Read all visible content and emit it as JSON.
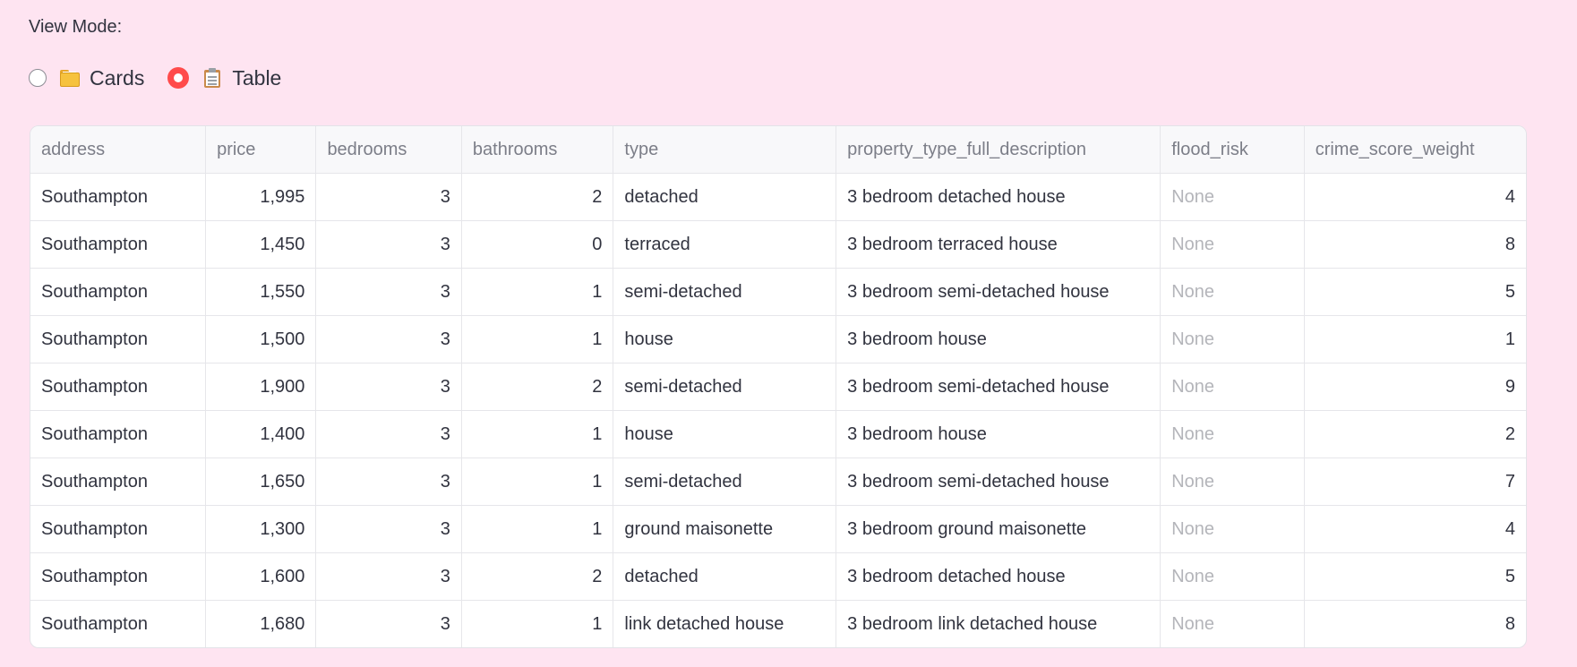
{
  "view_mode": {
    "label": "View Mode:",
    "options": [
      {
        "label": "Cards",
        "icon": "card-index-dividers-icon",
        "selected": false
      },
      {
        "label": "Table",
        "icon": "clipboard-icon",
        "selected": true
      }
    ],
    "accent_color": "#ff4b4b"
  },
  "table": {
    "columns": [
      "address",
      "price",
      "bedrooms",
      "bathrooms",
      "type",
      "property_type_full_description",
      "flood_risk",
      "crime_score_weight"
    ],
    "rows": [
      [
        "Southampton",
        "1,995",
        "3",
        "2",
        "detached",
        "3 bedroom detached house",
        "None",
        "4"
      ],
      [
        "Southampton",
        "1,450",
        "3",
        "0",
        "terraced",
        "3 bedroom terraced house",
        "None",
        "8"
      ],
      [
        "Southampton",
        "1,550",
        "3",
        "1",
        "semi-detached",
        "3 bedroom semi-detached house",
        "None",
        "5"
      ],
      [
        "Southampton",
        "1,500",
        "3",
        "1",
        "house",
        "3 bedroom house",
        "None",
        "1"
      ],
      [
        "Southampton",
        "1,900",
        "3",
        "2",
        "semi-detached",
        "3 bedroom semi-detached house",
        "None",
        "9"
      ],
      [
        "Southampton",
        "1,400",
        "3",
        "1",
        "house",
        "3 bedroom house",
        "None",
        "2"
      ],
      [
        "Southampton",
        "1,650",
        "3",
        "1",
        "semi-detached",
        "3 bedroom semi-detached house",
        "None",
        "7"
      ],
      [
        "Southampton",
        "1,300",
        "3",
        "1",
        "ground maisonette",
        "3 bedroom ground maisonette",
        "None",
        "4"
      ],
      [
        "Southampton",
        "1,600",
        "3",
        "2",
        "detached",
        "3 bedroom detached house",
        "None",
        "5"
      ],
      [
        "Southampton",
        "1,680",
        "3",
        "1",
        "link detached house",
        "3 bedroom link detached house",
        "None",
        "8"
      ]
    ]
  }
}
